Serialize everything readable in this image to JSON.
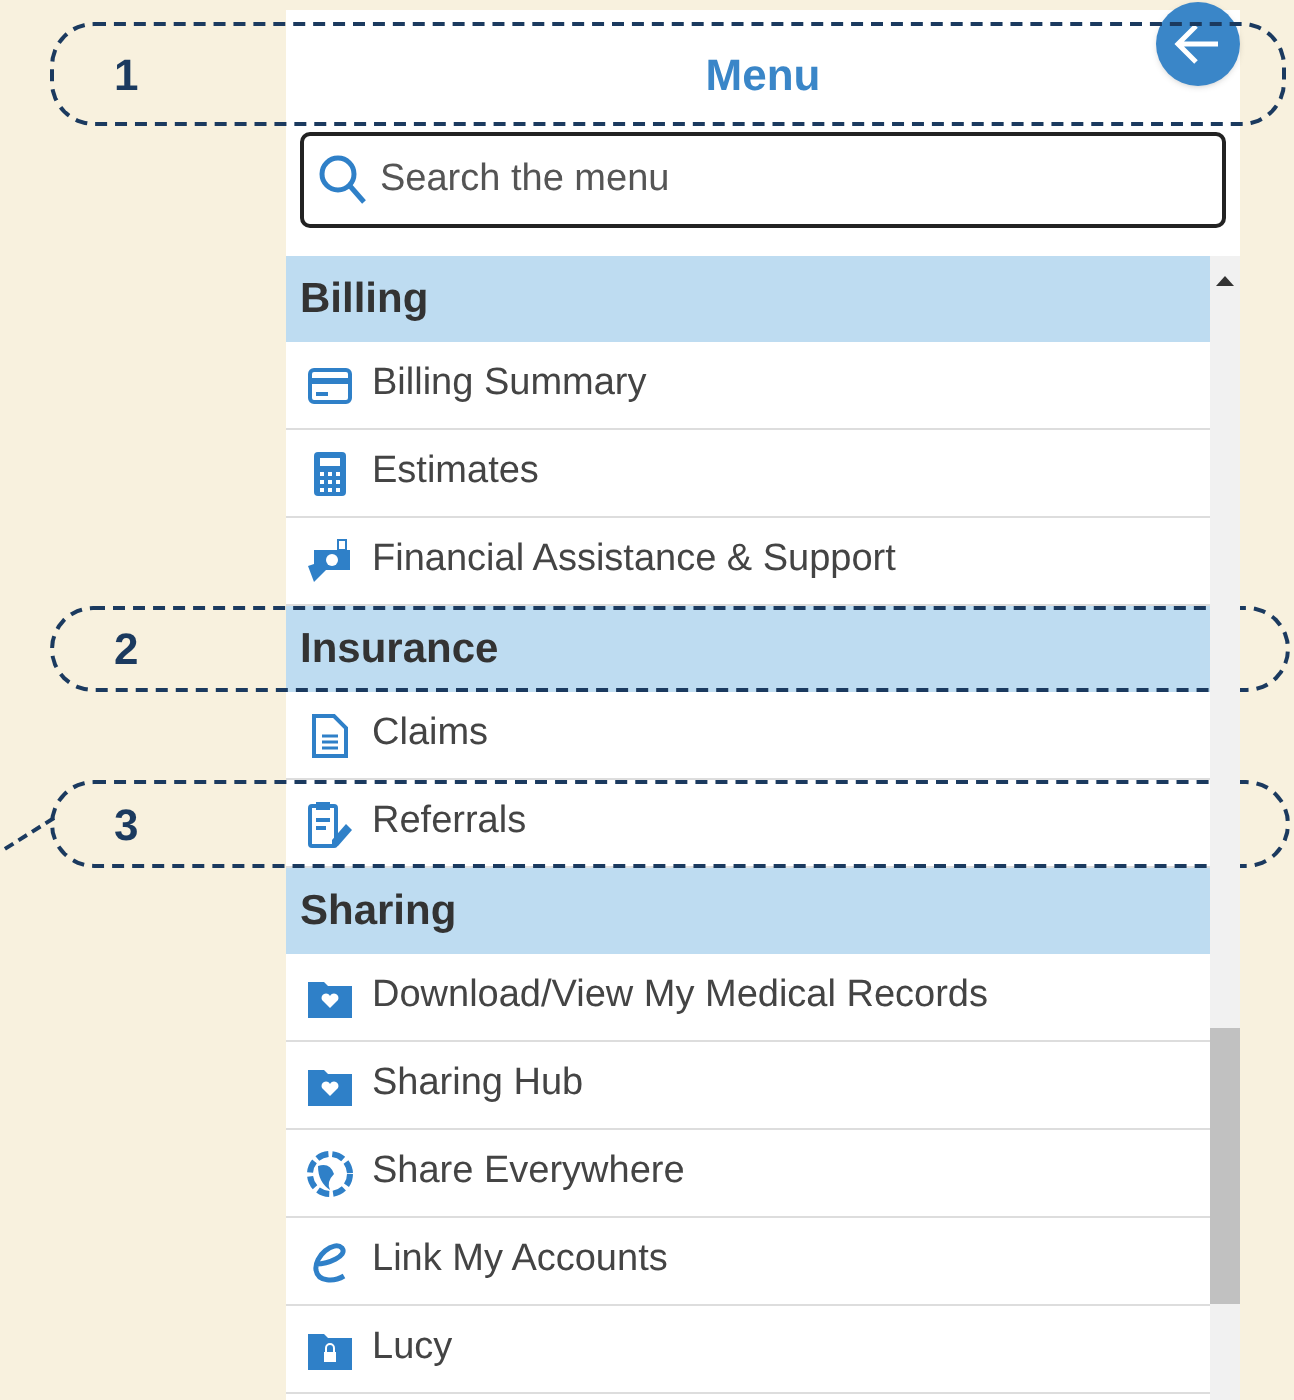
{
  "header": {
    "title": "Menu",
    "callout": "1"
  },
  "search": {
    "placeholder": "Search the menu"
  },
  "sections": [
    {
      "title": "Billing",
      "items": [
        {
          "label": "Billing Summary"
        },
        {
          "label": "Estimates"
        },
        {
          "label": "Financial Assistance & Support"
        }
      ]
    },
    {
      "title": "Insurance",
      "callout": "2",
      "items": [
        {
          "label": "Claims"
        },
        {
          "label": "Referrals",
          "callout": "3"
        }
      ]
    },
    {
      "title": "Sharing",
      "items": [
        {
          "label": "Download/View My Medical Records"
        },
        {
          "label": "Sharing Hub"
        },
        {
          "label": "Share Everywhere"
        },
        {
          "label": "Link My Accounts"
        },
        {
          "label": "Lucy"
        }
      ]
    }
  ]
}
